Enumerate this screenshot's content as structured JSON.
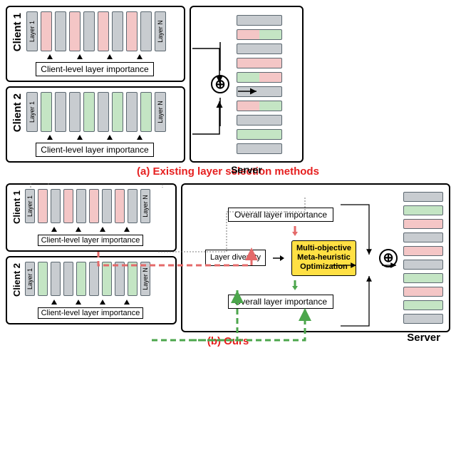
{
  "titleA": "(a) Existing layer selection methods",
  "titleB": "(b) Ours",
  "serverLabel": "Server",
  "client1": "Client 1",
  "client2": "Client 2",
  "layer1": "Layer 1",
  "layerN": "Layer N",
  "clientImportance": "Client-level layer importance",
  "overallImportance": "Overall layer importance",
  "layerDiversity": "Layer diversity",
  "optBox": {
    "l1": "Multi-objective",
    "l2": "Meta-heuristic",
    "l3": "Optimization"
  },
  "topA": {
    "client1Colors": [
      "gray",
      "pink",
      "gray",
      "pink",
      "gray",
      "pink",
      "gray",
      "pink",
      "gray",
      "gray"
    ],
    "client2Colors": [
      "gray",
      "green",
      "gray",
      "gray",
      "green",
      "gray",
      "green",
      "gray",
      "green",
      "gray"
    ],
    "serverColors": [
      "gray",
      "mix-pg",
      "gray",
      "pink",
      "mix-gp",
      "gray",
      "mix-pg",
      "gray",
      "green",
      "gray"
    ]
  },
  "bottomB": {
    "client1Colors": [
      "gray",
      "pink",
      "gray",
      "pink",
      "gray",
      "pink",
      "gray",
      "pink",
      "gray",
      "gray"
    ],
    "client2Colors": [
      "gray",
      "green",
      "gray",
      "gray",
      "green",
      "gray",
      "green",
      "gray",
      "green",
      "gray"
    ],
    "serverColors": [
      "gray",
      "green",
      "pink",
      "gray",
      "pink",
      "gray",
      "green",
      "pink",
      "green",
      "gray"
    ]
  }
}
